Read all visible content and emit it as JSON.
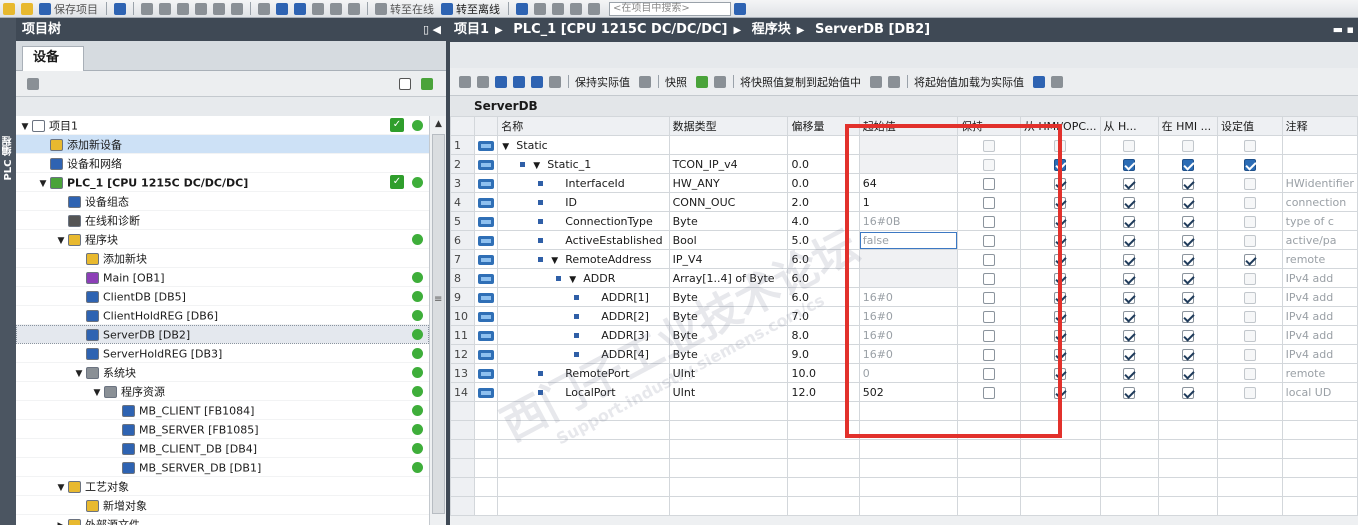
{
  "toolbar": {
    "save_project": "保存项目",
    "go_online": "转至在线",
    "go_offline": "转至离线",
    "search_placeholder": "<在项目中搜索>"
  },
  "left_panel": {
    "vertical_tab": "PLC 编程",
    "title": "项目树",
    "devices_tab": "设备"
  },
  "tree": [
    {
      "label": "项目1",
      "indent": 0,
      "arrow": "▼",
      "icon": "project-icon",
      "status": "check",
      "color": "#ffffff"
    },
    {
      "label": "添加新设备",
      "indent": 1,
      "arrow": "",
      "icon": "add-device-icon",
      "status": "",
      "hl": true
    },
    {
      "label": "设备和网络",
      "indent": 1,
      "arrow": "",
      "icon": "network-icon",
      "status": ""
    },
    {
      "label": "PLC_1 [CPU 1215C DC/DC/DC]",
      "indent": 1,
      "arrow": "▼",
      "icon": "plc-icon",
      "status": "check+dot",
      "bold": true
    },
    {
      "label": "设备组态",
      "indent": 2,
      "arrow": "",
      "icon": "device-config-icon",
      "status": ""
    },
    {
      "label": "在线和诊断",
      "indent": 2,
      "arrow": "",
      "icon": "diagnostics-icon",
      "status": ""
    },
    {
      "label": "程序块",
      "indent": 2,
      "arrow": "▼",
      "icon": "folder-icon",
      "status": "dot"
    },
    {
      "label": "添加新块",
      "indent": 3,
      "arrow": "",
      "icon": "add-block-icon",
      "status": ""
    },
    {
      "label": "Main [OB1]",
      "indent": 3,
      "arrow": "",
      "icon": "ob-icon",
      "status": "dot"
    },
    {
      "label": "ClientDB [DB5]",
      "indent": 3,
      "arrow": "",
      "icon": "db-icon",
      "status": "dot"
    },
    {
      "label": "ClientHoldREG [DB6]",
      "indent": 3,
      "arrow": "",
      "icon": "db-icon",
      "status": "dot"
    },
    {
      "label": "ServerDB [DB2]",
      "indent": 3,
      "arrow": "",
      "icon": "db-icon",
      "status": "dot",
      "selected": true
    },
    {
      "label": "ServerHoldREG [DB3]",
      "indent": 3,
      "arrow": "",
      "icon": "db-icon",
      "status": "dot"
    },
    {
      "label": "系统块",
      "indent": 3,
      "arrow": "▼",
      "icon": "system-folder-icon",
      "status": "dot"
    },
    {
      "label": "程序资源",
      "indent": 4,
      "arrow": "▼",
      "icon": "system-folder-icon",
      "status": "dot"
    },
    {
      "label": "MB_CLIENT [FB1084]",
      "indent": 5,
      "arrow": "",
      "icon": "fb-icon",
      "status": "dot"
    },
    {
      "label": "MB_SERVER [FB1085]",
      "indent": 5,
      "arrow": "",
      "icon": "fb-icon",
      "status": "dot"
    },
    {
      "label": "MB_CLIENT_DB [DB4]",
      "indent": 5,
      "arrow": "",
      "icon": "db-icon",
      "status": "dot"
    },
    {
      "label": "MB_SERVER_DB [DB1]",
      "indent": 5,
      "arrow": "",
      "icon": "db-icon",
      "status": "dot"
    },
    {
      "label": "工艺对象",
      "indent": 2,
      "arrow": "▼",
      "icon": "folder-icon",
      "status": ""
    },
    {
      "label": "新增对象",
      "indent": 3,
      "arrow": "",
      "icon": "add-block-icon",
      "status": ""
    },
    {
      "label": "外部源文件",
      "indent": 2,
      "arrow": "▶",
      "icon": "folder-icon",
      "status": ""
    }
  ],
  "breadcrumb": [
    "项目1",
    "PLC_1 [CPU 1215C DC/DC/DC]",
    "程序块",
    "ServerDB [DB2]"
  ],
  "editor_toolbar": {
    "keep_actual": "保持实际值",
    "snapshot": "快照",
    "copy_snapshot": "将快照值复制到起始值中",
    "load_start": "将起始值加载为实际值"
  },
  "db_title": "ServerDB",
  "columns": [
    "名称",
    "数据类型",
    "偏移量",
    "起始值",
    "保持",
    "从 HMI/OPC...",
    "从 H...",
    "在 HMI ...",
    "设定值",
    "注释"
  ],
  "rows": [
    {
      "n": "1",
      "name": "Static",
      "indent": 0,
      "arrow": "▼",
      "type": "",
      "offset": "",
      "start": "",
      "retain": "dis",
      "hmi1": "dis",
      "hmi2": "dis",
      "hmi3": "dis",
      "set": "dis",
      "comment": ""
    },
    {
      "n": "2",
      "name": "Static_1",
      "indent": 1,
      "arrow": "▼",
      "type": "TCON_IP_v4",
      "offset": "0.0",
      "start": "",
      "retain": "dis",
      "hmi1": "blue",
      "hmi2": "blue",
      "hmi3": "blue",
      "set": "blue",
      "comment": ""
    },
    {
      "n": "3",
      "name": "InterfaceId",
      "indent": 2,
      "arrow": "",
      "type": "HW_ANY",
      "offset": "0.0",
      "start": "64",
      "retain": "off",
      "hmi1": "on",
      "hmi2": "on",
      "hmi3": "on",
      "set": "dis",
      "comment": "HWidentifier"
    },
    {
      "n": "4",
      "name": "ID",
      "indent": 2,
      "arrow": "",
      "type": "CONN_OUC",
      "offset": "2.0",
      "start": "1",
      "retain": "off",
      "hmi1": "on",
      "hmi2": "on",
      "hmi3": "on",
      "set": "dis",
      "comment": "connection"
    },
    {
      "n": "5",
      "name": "ConnectionType",
      "indent": 2,
      "arrow": "",
      "type": "Byte",
      "offset": "4.0",
      "start": "16#0B",
      "retain": "off",
      "hmi1": "on",
      "hmi2": "on",
      "hmi3": "on",
      "set": "dis",
      "comment": "type of c",
      "dim": true
    },
    {
      "n": "6",
      "name": "ActiveEstablished",
      "indent": 2,
      "arrow": "",
      "type": "Bool",
      "offset": "5.0",
      "start": "false",
      "retain": "off",
      "hmi1": "on",
      "hmi2": "on",
      "hmi3": "on",
      "set": "dis",
      "comment": "active/pa",
      "dim": true,
      "edit": true
    },
    {
      "n": "7",
      "name": "RemoteAddress",
      "indent": 2,
      "arrow": "▼",
      "type": "IP_V4",
      "offset": "6.0",
      "start": "",
      "retain": "off",
      "hmi1": "on",
      "hmi2": "on",
      "hmi3": "on",
      "set": "on",
      "comment": "remote"
    },
    {
      "n": "8",
      "name": "ADDR",
      "indent": 3,
      "arrow": "▼",
      "type": "Array[1..4] of Byte",
      "offset": "6.0",
      "start": "",
      "retain": "off",
      "hmi1": "on",
      "hmi2": "on",
      "hmi3": "on",
      "set": "dis",
      "comment": "IPv4 add"
    },
    {
      "n": "9",
      "name": "ADDR[1]",
      "indent": 4,
      "arrow": "",
      "type": "Byte",
      "offset": "6.0",
      "start": "16#0",
      "retain": "off",
      "hmi1": "on",
      "hmi2": "on",
      "hmi3": "on",
      "set": "dis",
      "comment": "IPv4 add",
      "dim": true
    },
    {
      "n": "10",
      "name": "ADDR[2]",
      "indent": 4,
      "arrow": "",
      "type": "Byte",
      "offset": "7.0",
      "start": "16#0",
      "retain": "off",
      "hmi1": "on",
      "hmi2": "on",
      "hmi3": "on",
      "set": "dis",
      "comment": "IPv4 add",
      "dim": true
    },
    {
      "n": "11",
      "name": "ADDR[3]",
      "indent": 4,
      "arrow": "",
      "type": "Byte",
      "offset": "8.0",
      "start": "16#0",
      "retain": "off",
      "hmi1": "on",
      "hmi2": "on",
      "hmi3": "on",
      "set": "dis",
      "comment": "IPv4 add",
      "dim": true
    },
    {
      "n": "12",
      "name": "ADDR[4]",
      "indent": 4,
      "arrow": "",
      "type": "Byte",
      "offset": "9.0",
      "start": "16#0",
      "retain": "off",
      "hmi1": "on",
      "hmi2": "on",
      "hmi3": "on",
      "set": "dis",
      "comment": "IPv4 add",
      "dim": true
    },
    {
      "n": "13",
      "name": "RemotePort",
      "indent": 2,
      "arrow": "",
      "type": "UInt",
      "offset": "10.0",
      "start": "0",
      "retain": "off",
      "hmi1": "on",
      "hmi2": "on",
      "hmi3": "on",
      "set": "dis",
      "comment": "remote",
      "dim": true
    },
    {
      "n": "14",
      "name": "LocalPort",
      "indent": 2,
      "arrow": "",
      "type": "UInt",
      "offset": "12.0",
      "start": "502",
      "retain": "off",
      "hmi1": "on",
      "hmi2": "on",
      "hmi3": "on",
      "set": "dis",
      "comment": "local UD"
    }
  ],
  "watermark": {
    "line1": "西门子工业技术论坛",
    "line2": "Support.industry.siemens.com/cs"
  },
  "colors": {
    "title_bar": "#3f4955",
    "status_green": "#3eae3a",
    "highlight_box": "#e2312c",
    "checkbox_blue": "#2b6cb5"
  }
}
